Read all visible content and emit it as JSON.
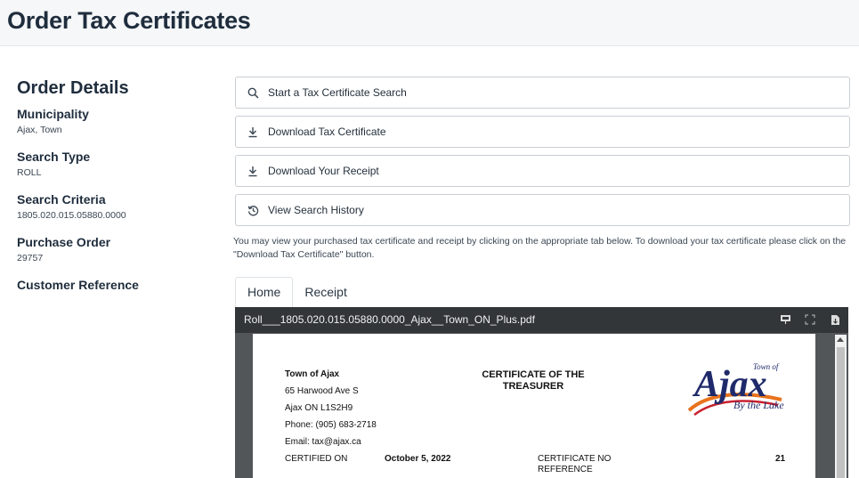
{
  "header": {
    "title": "Order Tax Certificates"
  },
  "sidebar": {
    "title": "Order Details",
    "details": [
      {
        "label": "Municipality",
        "value": "Ajax, Town"
      },
      {
        "label": "Search Type",
        "value": "ROLL"
      },
      {
        "label": "Search Criteria",
        "value": "1805.020.015.05880.0000"
      },
      {
        "label": "Purchase Order",
        "value": "29757"
      },
      {
        "label": "Customer Reference",
        "value": ""
      }
    ]
  },
  "actions": [
    {
      "label": "Start a Tax Certificate Search",
      "icon": "search-icon"
    },
    {
      "label": "Download Tax Certificate",
      "icon": "download-icon"
    },
    {
      "label": "Download Your Receipt",
      "icon": "download-icon"
    },
    {
      "label": "View Search History",
      "icon": "history-icon"
    }
  ],
  "info_text": "You may view your purchased tax certificate and receipt by clicking on the appropriate tab below. To download your tax certificate please click on the \"Download Tax Certificate\" button.",
  "tabs": [
    {
      "label": "Home",
      "active": true
    },
    {
      "label": "Receipt",
      "active": false
    }
  ],
  "viewer": {
    "filename": "Roll___1805.020.015.05880.0000_Ajax__Town_ON_Plus.pdf",
    "pdf": {
      "org_name": "Town of Ajax",
      "address1": "65 Harwood Ave S",
      "address2": "Ajax ON L1S2H9",
      "phone": "Phone: (905) 683-2718",
      "email": "Email: tax@ajax.ca",
      "heading_line1": "CERTIFICATE OF THE",
      "heading_line2": "TREASURER",
      "logo": {
        "small": "Town of",
        "main": "Ajax",
        "tagline": "By the Lake"
      },
      "certified_label": "CERTIFIED ON",
      "certified_value": "October 5, 2022",
      "cert_no_label": "CERTIFICATE NO",
      "reference_label": "REFERENCE",
      "cert_no_value": "21"
    }
  },
  "colors": {
    "viewer_bg": "#525659",
    "toolbar_bg": "#323639",
    "logo_navy": "#1f2a6b",
    "logo_orange": "#e8731c",
    "logo_red": "#c8202f"
  }
}
